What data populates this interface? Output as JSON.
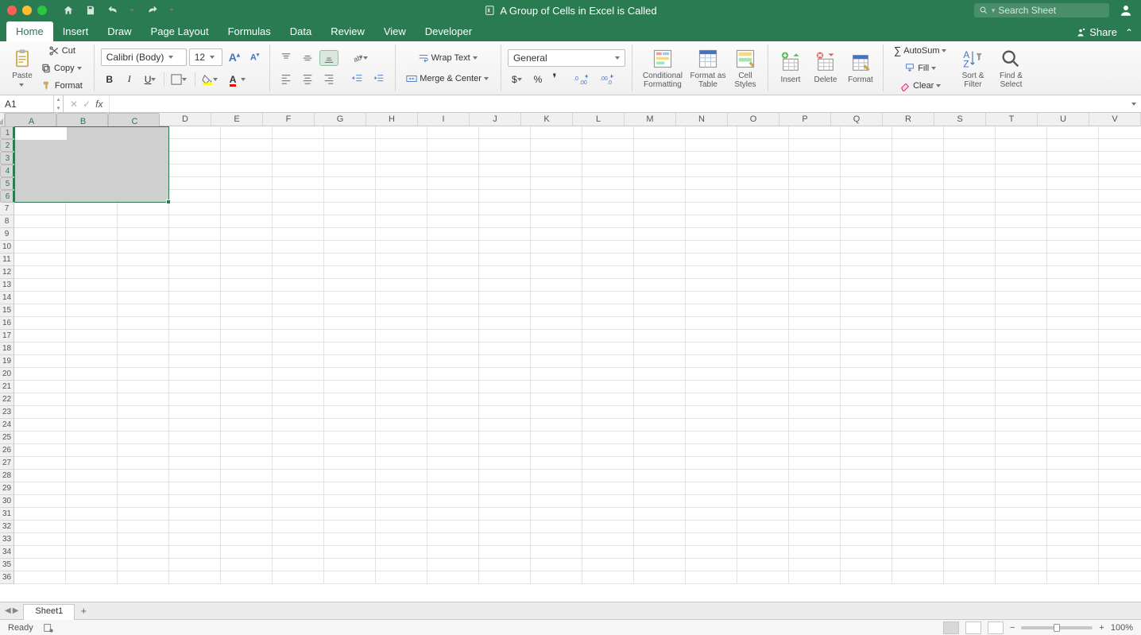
{
  "titlebar": {
    "title": "A Group of Cells in Excel is Called",
    "search_placeholder": "Search Sheet"
  },
  "tabs": {
    "items": [
      "Home",
      "Insert",
      "Draw",
      "Page Layout",
      "Formulas",
      "Data",
      "Review",
      "View",
      "Developer"
    ],
    "share": "Share"
  },
  "ribbon": {
    "paste": "Paste",
    "cut": "Cut",
    "copy": "Copy",
    "format_painter": "Format",
    "font_name": "Calibri (Body)",
    "font_size": "12",
    "wrap": "Wrap Text",
    "merge": "Merge & Center",
    "number_format": "General",
    "cond_fmt": "Conditional Formatting",
    "fmt_table": "Format as Table",
    "cell_styles": "Cell Styles",
    "insert": "Insert",
    "delete": "Delete",
    "format": "Format",
    "autosum": "AutoSum",
    "fill": "Fill",
    "clear": "Clear",
    "sort_filter": "Sort & Filter",
    "find_select": "Find & Select"
  },
  "formula_bar": {
    "name_box": "A1"
  },
  "grid": {
    "columns": [
      "A",
      "B",
      "C",
      "D",
      "E",
      "F",
      "G",
      "H",
      "I",
      "J",
      "K",
      "L",
      "M",
      "N",
      "O",
      "P",
      "Q",
      "R",
      "S",
      "T",
      "U",
      "V"
    ],
    "rows": 36,
    "selected_cols": [
      "A",
      "B",
      "C"
    ],
    "selected_rows": [
      1,
      2,
      3,
      4,
      5,
      6
    ],
    "active_cell": "A1"
  },
  "sheets": {
    "active": "Sheet1"
  },
  "status": {
    "ready": "Ready",
    "zoom": "100%"
  }
}
